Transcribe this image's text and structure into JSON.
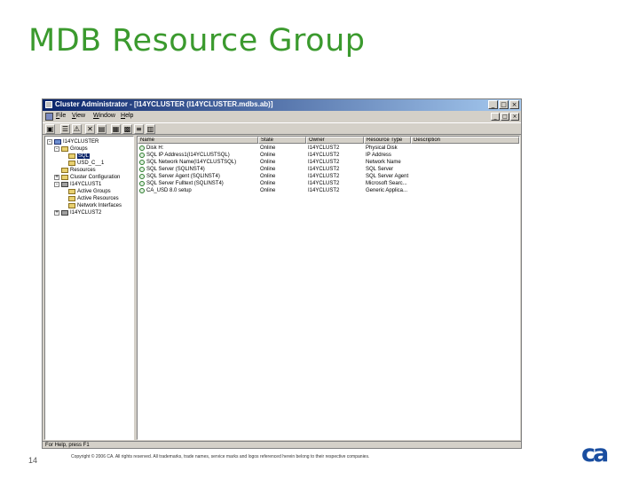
{
  "slide": {
    "title": "MDB Resource Group",
    "page_number": "14",
    "copyright": "Copyright © 2006 CA. All rights reserved. All trademarks, trade names, service marks and logos referenced herein belong to their respective companies.",
    "logo_text": "ca"
  },
  "window": {
    "title": "Cluster Administrator - [I14YCLUSTER (I14YCLUSTER.mdbs.ab)]",
    "controls": [
      "_",
      "□",
      "×"
    ],
    "menu": [
      "File",
      "View",
      "Window",
      "Help"
    ],
    "mdi_controls": [
      "_",
      "□",
      "×"
    ],
    "status_text": "For Help, press F1"
  },
  "tree": {
    "root": "I14YCLUSTER",
    "groups": "Groups",
    "group_sql": "SQL",
    "group_usd": "USD_C__1",
    "resources": "Resources",
    "cluster_config": "Cluster Configuration",
    "node1": "I14YCLUST1",
    "active_groups": "Active Groups",
    "active_resources": "Active Resources",
    "network_interfaces": "Network Interfaces",
    "node2": "I14YCLUST2"
  },
  "list": {
    "columns": [
      "Name",
      "State",
      "Owner",
      "Resource Type",
      "Description"
    ],
    "rows": [
      {
        "name": "Disk H:",
        "state": "Online",
        "owner": "I14YCLUST2",
        "type": "Physical Disk",
        "desc": ""
      },
      {
        "name": "SQL IP Address1(I14YCLUSTSQL)",
        "state": "Online",
        "owner": "I14YCLUST2",
        "type": "IP Address",
        "desc": ""
      },
      {
        "name": "SQL Network Name(I14YCLUSTSQL)",
        "state": "Online",
        "owner": "I14YCLUST2",
        "type": "Network Name",
        "desc": ""
      },
      {
        "name": "SQL Server (SQLINST4)",
        "state": "Online",
        "owner": "I14YCLUST2",
        "type": "SQL Server",
        "desc": ""
      },
      {
        "name": "SQL Server Agent (SQLINST4)",
        "state": "Online",
        "owner": "I14YCLUST2",
        "type": "SQL Server Agent",
        "desc": ""
      },
      {
        "name": "SQL Server Fulltext (SQLINST4)",
        "state": "Online",
        "owner": "I14YCLUST2",
        "type": "Microsoft Searc...",
        "desc": ""
      },
      {
        "name": "CA_USD 8.0 setup",
        "state": "Online",
        "owner": "I14YCLUST2",
        "type": "Generic Applica...",
        "desc": ""
      }
    ]
  },
  "colors": {
    "title_green": "#3b9a2e",
    "titlebar_blue": "#0a246a",
    "window_gray": "#d4d0c8",
    "logo_blue": "#1a4ea0"
  }
}
